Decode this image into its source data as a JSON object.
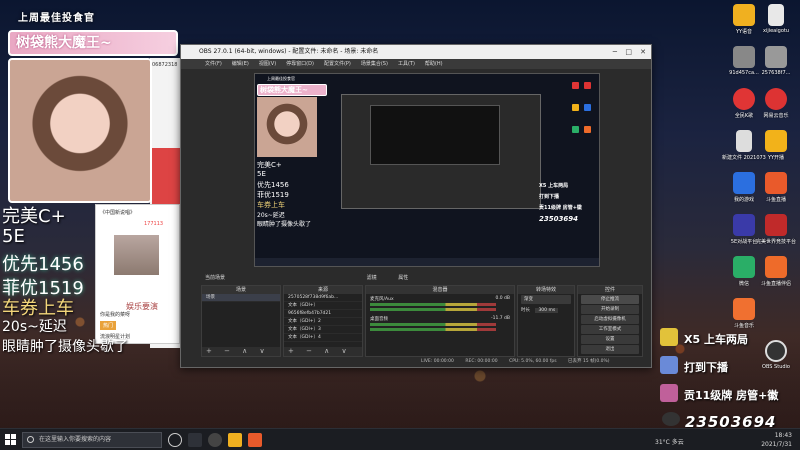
{
  "overlay_left": {
    "top_banner": "上周最佳投食官",
    "name_ribbon": "树袋熊大魔王~",
    "id_fragment": "06872318",
    "lines": [
      "完美C+",
      "5E",
      "优先1456",
      "菲优1519",
      "车券上车",
      "20s~延迟",
      "眼睛肿了摄像头歇了"
    ],
    "card_label": "娱乐要演",
    "card_tag": "热门",
    "card_count": "177113",
    "card_snippets": [
      "《中国新说唱》",
      "你是我的菜呀",
      "流浪明星计划"
    ]
  },
  "obs": {
    "title": "OBS 27.0.1 (64-bit, windows) - 配置文件: 未命名 - 场景: 未命名",
    "menu": [
      "文件(F)",
      "编辑(E)",
      "视图(V)",
      "停靠窗口(D)",
      "配置文件(P)",
      "场景集合(S)",
      "工具(T)",
      "帮助(H)"
    ],
    "window_controls": [
      "─",
      "□",
      "✕"
    ],
    "preview": {
      "top_banner": "上周最佳投食官",
      "name_ribbon": "树袋熊大魔王~",
      "lines": [
        "完美C+",
        "5E",
        "优先1456",
        "菲优1519",
        "车券上车",
        "20s~延迟",
        "眼睛肿了摄像头歇了"
      ],
      "right_lines": [
        "X5 上车两局",
        "打到下播",
        "贡11级牌 房管+徽",
        "23503694"
      ]
    },
    "scene_bar": [
      "当前场景",
      "滤镜",
      "属性"
    ],
    "panels": {
      "scenes": {
        "title": "场景",
        "items": [
          "场景"
        ]
      },
      "sources": {
        "title": "来源",
        "items": [
          "2570528f738d9f6ab...",
          "文本（GDI+）",
          "9656f8efb47b7d21",
          "文本（GDI+）2",
          "文本（GDI+）3",
          "文本（GDI+）4"
        ]
      },
      "mixer": {
        "title": "混音器",
        "channels": [
          {
            "name": "麦克风/Aux",
            "db": "0.0 dB"
          },
          {
            "name": "桌面音频",
            "db": "-11.7 dB"
          }
        ]
      },
      "transitions": {
        "title": "转场特效",
        "type": "渐变",
        "duration_label": "时长",
        "duration": "300 ms"
      },
      "controls": {
        "title": "控件",
        "buttons": [
          "停止推流",
          "开始录制",
          "启动虚拟摄像机",
          "工作室模式",
          "设置",
          "退出"
        ]
      },
      "footer_glyphs": "+ − ∧ ∨"
    },
    "status": {
      "live": "LIVE: 00:00:00",
      "rec": "REC: 00:00:00",
      "cpu": "CPU: 5.0%, 60.00 fps",
      "kbps": "已丢弃 15 帧(0.0%)"
    }
  },
  "overlay_right": {
    "lines": [
      "X5 上车两局",
      "打到下播",
      "贡11级牌 房管+徽"
    ],
    "number": "23503694"
  },
  "desktop_icons": [
    {
      "label": "YY语音",
      "color": "#f0b020"
    },
    {
      "label": "xijieaigotu",
      "color": "#e8e8e8"
    },
    {
      "label": "91d457ca...",
      "color": "#888"
    },
    {
      "label": "257638f7...",
      "color": "#999"
    },
    {
      "label": "全民K歌",
      "color": "#e03535"
    },
    {
      "label": "网易云音乐",
      "color": "#d33"
    },
    {
      "label": "新建文件 2021073...",
      "color": "#ddd"
    },
    {
      "label": "YY开播",
      "color": "#f2b21a"
    },
    {
      "label": "我的游戏",
      "color": "#2b6fe0"
    },
    {
      "label": "斗鱼直播",
      "color": "#e95a2b"
    },
    {
      "label": "5E对战平台",
      "color": "#3a3aa8"
    },
    {
      "label": "完美世界竞技平台",
      "color": "#c02a2a"
    },
    {
      "label": "微信",
      "color": "#2aae67"
    },
    {
      "label": "斗鱼直播伴侣",
      "color": "#ee6b2a"
    },
    {
      "label": "斗鱼音乐",
      "color": "#f07030"
    },
    {
      "label": "OBS Studio",
      "color": "#333"
    }
  ],
  "taskbar": {
    "search_placeholder": "在这里输入你要搜索的内容",
    "weather": "31°C 多云",
    "time": "18:43",
    "date": "2021/7/31"
  },
  "colors": {
    "obs_bg": "#2b2b2b",
    "ribbon_pink": "#e9a7c3",
    "taskbar": "#1b1d22"
  }
}
